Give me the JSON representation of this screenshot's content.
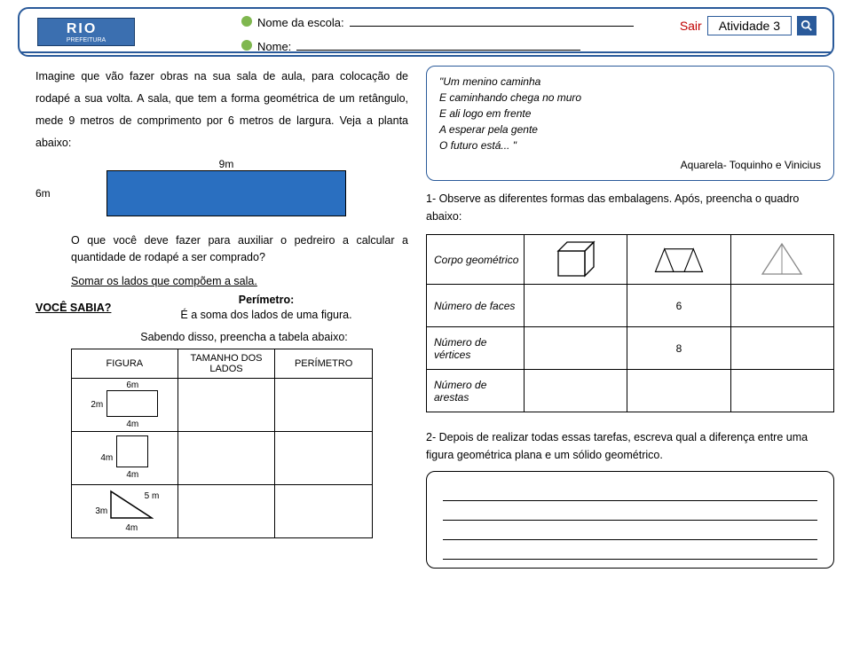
{
  "header": {
    "logo_main": "RIO",
    "logo_sub": "PREFEITURA",
    "school_label": "Nome da escola:",
    "name_label": "Nome:",
    "sair": "Sair",
    "activity": "Atividade 3"
  },
  "left": {
    "intro": "Imagine que vão fazer obras na sua sala de aula, para colocação de  rodapé a sua volta. A sala, que tem a forma geométrica de um retângulo, mede 9 metros de comprimento por 6 metros de largura. Veja a planta abaixo:",
    "dim_top": "9m",
    "dim_left": "6m",
    "question": "O que você deve fazer para auxiliar o pedreiro a calcular a quantidade de rodapé a ser comprado?",
    "somar": "Somar os lados que compõem a sala.",
    "voce_sabia": "VOCÊ SABIA?",
    "perimetro_title": "Perímetro:",
    "perimetro_def": "É a soma dos lados de  uma figura.",
    "sabendo": "Sabendo disso, preencha a tabela abaixo:",
    "table": {
      "h1": "FIGURA",
      "h2": "TAMANHO DOS LADOS",
      "h3": "PERÍMETRO",
      "r1": {
        "w": "6m",
        "h": "2m"
      },
      "r2": {
        "side": "4m"
      },
      "r3": {
        "a": "3m",
        "b": "4m",
        "c": "5 m"
      }
    }
  },
  "right": {
    "poem": {
      "l1": "\"Um menino caminha",
      "l2": "E caminhando chega no muro",
      "l3": "E ali logo em frente",
      "l4": "A esperar pela gente",
      "l5": "O futuro está... \"",
      "credit": "Aquarela- Toquinho e Vinicius"
    },
    "obs": "1- Observe as diferentes formas das embalagens. Após, preencha o quadro abaixo:",
    "solids_header": "Corpo geométrico",
    "rows": {
      "faces": "Número de faces",
      "vertices": "Número de vértices",
      "arestas": "Número de arestas"
    },
    "vals": {
      "faces_prism": "6",
      "vertices_prism": "8"
    },
    "q2": "2- Depois de realizar  todas essas tarefas, escreva  qual a diferença entre uma figura geométrica plana e um sólido geométrico."
  },
  "chart_data": {
    "type": "table",
    "title": "Corpo geométrico",
    "columns": [
      "Cubo",
      "Prisma triangular",
      "Pirâmide quadrangular"
    ],
    "rows": [
      {
        "label": "Número de faces",
        "values": [
          null,
          6,
          null
        ]
      },
      {
        "label": "Número de vértices",
        "values": [
          null,
          8,
          null
        ]
      },
      {
        "label": "Número de arestas",
        "values": [
          null,
          null,
          null
        ]
      }
    ]
  }
}
